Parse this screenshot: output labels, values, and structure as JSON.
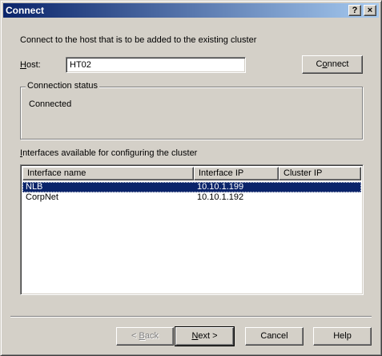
{
  "window": {
    "title": "Connect",
    "help_button": "?",
    "close_button": "×"
  },
  "instruction": "Connect to the host that is to be added to the existing cluster",
  "host": {
    "label_accesskey": "H",
    "label_rest": "ost:",
    "value": "HT02"
  },
  "connect_button": {
    "pre": "C",
    "accesskey": "o",
    "post": "nnect"
  },
  "connection_status": {
    "caption": "Connection status",
    "text": "Connected"
  },
  "interfaces": {
    "label_accesskey": "I",
    "label_rest": "nterfaces available for configuring the cluster",
    "columns": [
      "Interface name",
      "Interface IP",
      "Cluster IP"
    ],
    "rows": [
      {
        "name": "NLB",
        "ip": "10.10.1.199",
        "cluster_ip": "",
        "selected": true
      },
      {
        "name": "CorpNet",
        "ip": "10.10.1.192",
        "cluster_ip": "",
        "selected": false
      }
    ]
  },
  "footer": {
    "back": {
      "pre": "< ",
      "accesskey": "B",
      "post": "ack"
    },
    "next": {
      "accesskey": "N",
      "post": "ext >"
    },
    "cancel": "Cancel",
    "help": "Help"
  },
  "colors": {
    "face": "#d4d0c8",
    "selection": "#0a246a",
    "title_gradient_start": "#0a246a",
    "title_gradient_end": "#a6caf0"
  }
}
